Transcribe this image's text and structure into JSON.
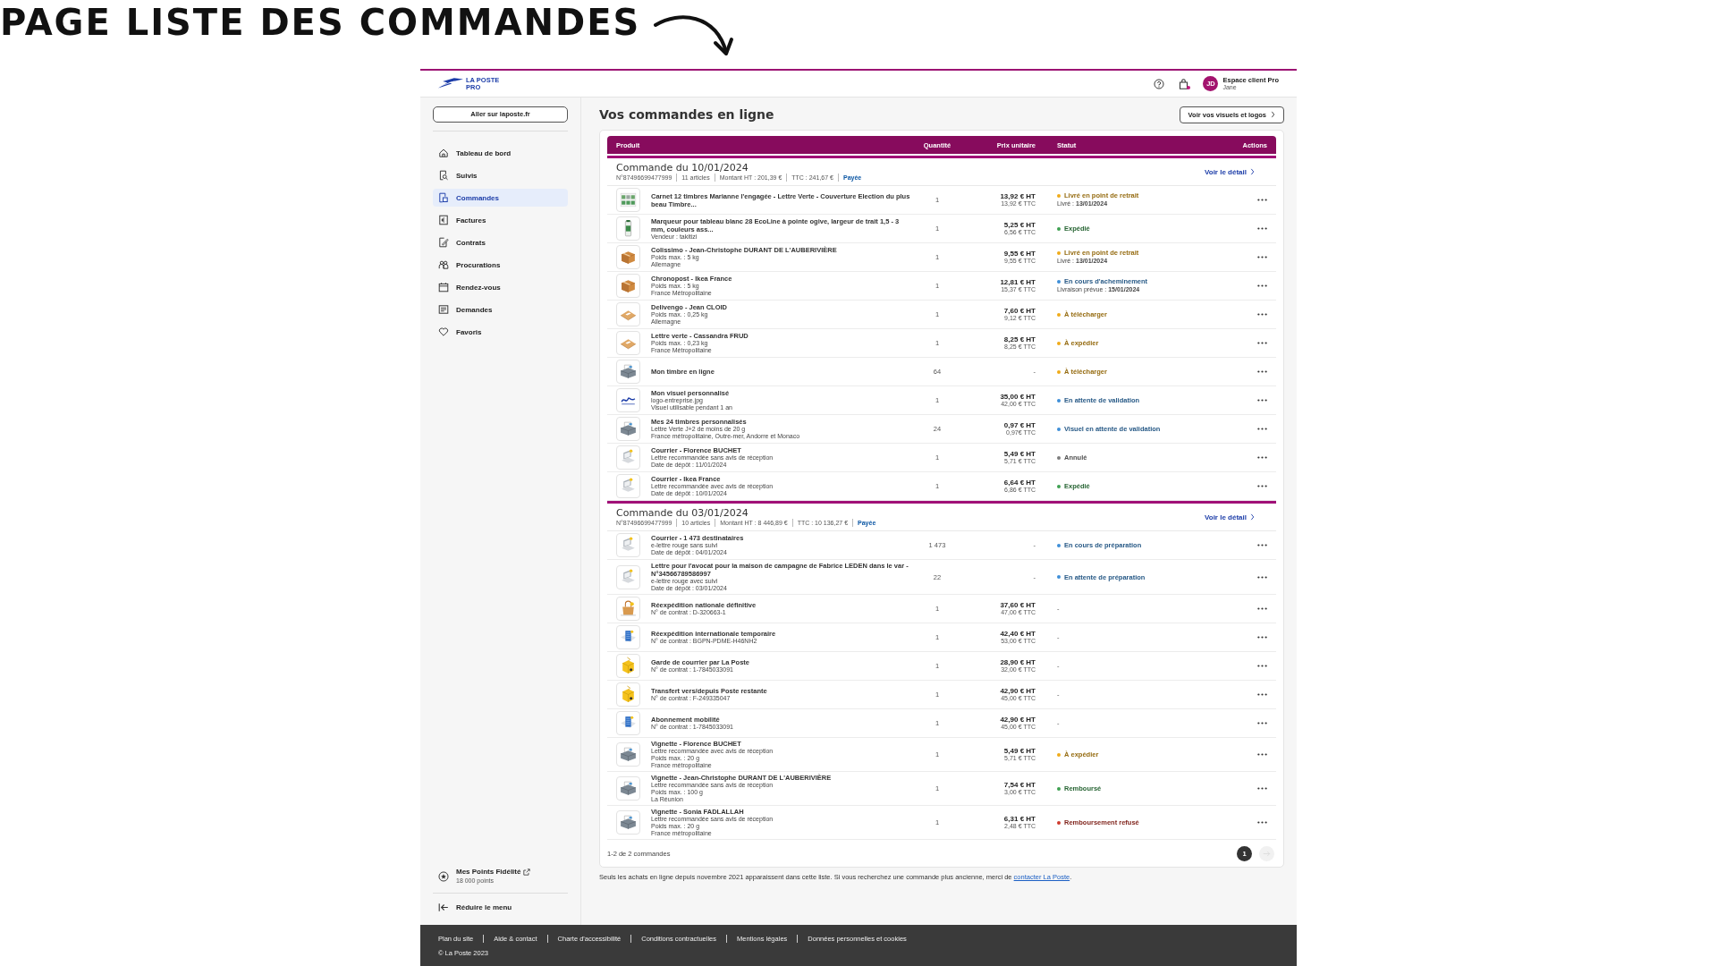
{
  "slide_title": "PAGE LISTE DES COMMANDES",
  "header": {
    "logo": [
      "LA POSTE",
      "PRO"
    ],
    "avatar": "JD",
    "account": "Espace client Pro",
    "user": "Jane",
    "cart_badge": true
  },
  "sidebar": {
    "top_button": "Aller sur laposte.fr",
    "items": [
      {
        "label": "Tableau de bord",
        "selected": false
      },
      {
        "label": "Suivis",
        "selected": false
      },
      {
        "label": "Commandes",
        "selected": true
      },
      {
        "label": "Factures",
        "selected": false
      },
      {
        "label": "Contrats",
        "selected": false
      },
      {
        "label": "Procurations",
        "selected": false
      },
      {
        "label": "Rendez-vous",
        "selected": false
      },
      {
        "label": "Demandes",
        "selected": false
      },
      {
        "label": "Favoris",
        "selected": false
      }
    ],
    "loyalty": {
      "title": "Mes Points Fidélité",
      "points": "18 000 points"
    },
    "collapse": "Réduire le menu"
  },
  "main": {
    "title": "Vos commandes en ligne",
    "visuals_button": "Voir vos visuels et logos",
    "columns": [
      "Produit",
      "Quantité",
      "Prix unitaire",
      "Statut",
      "Actions"
    ],
    "orders": [
      {
        "title": "Commande du 10/01/2024",
        "meta": [
          "N°87496699477999",
          "11 articles",
          "Montant HT : 201,39 €",
          "TTC : 241,67 €"
        ],
        "payment": "Payée",
        "detail_link": "Voir le détail",
        "items": [
          {
            "kind": "stamps",
            "name": "Carnet 12 timbres Marianne l'engagée - Lettre Verte - Couverture Election du plus beau Timbre...",
            "qty": "1",
            "price_ht": "13,92 € HT",
            "price_ttc": "13,92 € TTC",
            "status": {
              "label": "Livré en point de retrait",
              "color": "#f0ac1a",
              "detail": "Livré : **13/01/2024**"
            }
          },
          {
            "kind": "marker",
            "name": "Marqueur pour tableau blanc 28 EcoLine à pointe ogive, largeur de trait 1,5 - 3 mm, couleurs ass...",
            "lines": [
              "Vendeur : takitizi"
            ],
            "qty": "1",
            "price_ht": "5,25 € HT",
            "price_ttc": "6,56 € TTC",
            "status": {
              "label": "Expédié",
              "color": "#3fa152"
            }
          },
          {
            "kind": "parcel",
            "name": "Colissimo - Jean-Christophe DURANT DE L'AUBERIVIÈRE",
            "lines": [
              "Poids max. : 5 kg",
              "Allemagne"
            ],
            "qty": "1",
            "price_ht": "9,55 € HT",
            "price_ttc": "9,55 € TTC",
            "status": {
              "label": "Livré en point de retrait",
              "color": "#f0ac1a",
              "detail": "Livré : **13/01/2024**"
            }
          },
          {
            "kind": "parcel",
            "name": "Chronopost - Ikea France",
            "lines": [
              "Poids max. : 5 kg",
              "France Métropolitaine"
            ],
            "qty": "1",
            "price_ht": "12,81 € HT",
            "price_ttc": "15,37 € TTC",
            "status": {
              "label": "En cours d'acheminement",
              "color": "#3f8fd8",
              "detail": "Livraison prévue : **15/01/2024**"
            }
          },
          {
            "kind": "envelope",
            "name": "Delivengo - Jean CLOID",
            "lines": [
              "Poids max. : 0,25 kg",
              "Allemagne"
            ],
            "qty": "1",
            "price_ht": "7,60 € HT",
            "price_ttc": "9,12 € TTC",
            "status": {
              "label": "À télécharger",
              "color": "#f0ac1a"
            }
          },
          {
            "kind": "envelope",
            "name": "Lettre verte - Cassandra FRUD",
            "lines": [
              "Poids max. : 0,23 kg",
              "France Métropolitaine"
            ],
            "qty": "1",
            "price_ht": "8,25 € HT",
            "price_ttc": "8,25 € TTC",
            "status": {
              "label": "À expédier",
              "color": "#f0ac1a"
            }
          },
          {
            "kind": "printer",
            "name": "Mon timbre en ligne",
            "qty": "64",
            "price_ht": "-",
            "status": {
              "label": "À télécharger",
              "color": "#f0ac1a"
            }
          },
          {
            "kind": "logo",
            "name": "Mon visuel personnalisé",
            "lines": [
              "logo-entreprise.jpg",
              "Visuel utilisable pendant 1 an"
            ],
            "qty": "1",
            "price_ht": "35,00 € HT",
            "price_ttc": "42,00 € TTC",
            "status": {
              "label": "En attente de validation",
              "color": "#3f8fd8"
            }
          },
          {
            "kind": "printer",
            "name": "Mes 24 timbres personnalisés",
            "lines": [
              "Lettre Verte J+2 de moins de 20 g",
              "France métropolitaine, Outre-mer, Andorre et Monaco"
            ],
            "qty": "24",
            "price_ht": "0,97 € HT",
            "price_ttc": "0,97€ TTC",
            "status": {
              "label": "Visuel en attente de validation",
              "color": "#3f8fd8"
            }
          },
          {
            "kind": "laptop",
            "name": "Courrier - Florence BUCHET",
            "lines": [
              "Lettre recommandée sans avis de réception",
              "Date de dépôt : 11/01/2024"
            ],
            "qty": "1",
            "price_ht": "5,49 € HT",
            "price_ttc": "5,71 € TTC",
            "status": {
              "label": "Annulé",
              "color": "#7d7d7d"
            }
          },
          {
            "kind": "laptop",
            "name": "Courrier - Ikea France",
            "lines": [
              "Lettre recommandée avec avis de réception",
              "Date de dépôt : 10/01/2024"
            ],
            "qty": "1",
            "price_ht": "6,64 € HT",
            "price_ttc": "6,86 € TTC",
            "status": {
              "label": "Expédié",
              "color": "#3fa152"
            }
          }
        ]
      },
      {
        "title": "Commande du 03/01/2024",
        "meta": [
          "N°87496699477999",
          "10 articles",
          "Montant HT : 8 446,89 €",
          "TTC : 10 136,27 €"
        ],
        "payment": "Payée",
        "detail_link": "Voir le détail",
        "items": [
          {
            "kind": "laptop",
            "name": "Courrier - 1 473 destinataires",
            "lines": [
              "e-lettre rouge sans suivi",
              "Date de dépôt : 04/01/2024"
            ],
            "qty": "1 473",
            "price_ht": "-",
            "status": {
              "label": "En cours de préparation",
              "color": "#3f8fd8"
            }
          },
          {
            "kind": "laptop",
            "name": "Lettre pour l'avocat pour la maison de campagne de Fabrice LEDEN dans le var - N°34566789586997",
            "lines": [
              "e-lettre rouge avec suivi",
              "Date de dépôt : 03/01/2024"
            ],
            "qty": "22",
            "price_ht": "-",
            "status": {
              "label": "En attente de préparation",
              "color": "#3f8fd8"
            }
          },
          {
            "kind": "bag",
            "name": "Réexpédition nationale définitive",
            "lines": [
              "N° de contrat : D-320663-1"
            ],
            "qty": "1",
            "price_ht": "37,60 € HT",
            "price_ttc": "47,00 € TTC",
            "status": {
              "label": "-"
            }
          },
          {
            "kind": "building",
            "name": "Réexpédition internationale temporaire",
            "lines": [
              "N° de contrat : BGPN-PDME-H46NH2"
            ],
            "qty": "1",
            "price_ht": "42,40 € HT",
            "price_ttc": "53,00 € TTC",
            "status": {
              "label": "-"
            }
          },
          {
            "kind": "mailbox",
            "name": "Garde de courrier par La Poste",
            "lines": [
              "N° de contrat : 1-7845033091"
            ],
            "qty": "1",
            "price_ht": "28,90 € HT",
            "price_ttc": "32,00 € TTC",
            "status": {
              "label": "-"
            }
          },
          {
            "kind": "mailbox",
            "name": "Transfert vers/depuis Poste restante",
            "lines": [
              "N° de contrat : F-249335047"
            ],
            "qty": "1",
            "price_ht": "42,90 € HT",
            "price_ttc": "45,00 € TTC",
            "status": {
              "label": "-"
            }
          },
          {
            "kind": "building",
            "name": "Abonnement mobilité",
            "lines": [
              "N° de contrat : 1-7845033091"
            ],
            "qty": "1",
            "price_ht": "42,90 € HT",
            "price_ttc": "45,00 € TTC",
            "status": {
              "label": "-"
            }
          },
          {
            "kind": "printer",
            "name": "Vignette - Florence BUCHET",
            "lines": [
              "Lettre recommandée avec avis de réception",
              "Poids max. : 20 g",
              "France métropolitaine"
            ],
            "qty": "1",
            "price_ht": "5,49 € HT",
            "price_ttc": "5,71 € TTC",
            "status": {
              "label": "À expédier",
              "color": "#f0ac1a"
            }
          },
          {
            "kind": "printer",
            "name": "Vignette - Jean-Christophe DURANT DE L'AUBERIVIÈRE",
            "lines": [
              "Lettre recommandée sans avis de réception",
              "Poids max. : 100 g",
              "La Réunion"
            ],
            "qty": "1",
            "price_ht": "7,54 € HT",
            "price_ttc": "3,00 € TTC",
            "status": {
              "label": "Remboursé",
              "color": "#3fa152"
            }
          },
          {
            "kind": "printer",
            "name": "Vignette - Sonia FADLALLAH",
            "lines": [
              "Lettre recommandée sans avis de réception",
              "Poids max. : 20 g",
              "France métropolitaine"
            ],
            "qty": "1",
            "price_ht": "6,31 € HT",
            "price_ttc": "2,48 € TTC",
            "status": {
              "label": "Remboursement refusé",
              "color": "#cf3b2e"
            }
          }
        ]
      }
    ],
    "pagination": {
      "summary": "1-2 de 2 commandes",
      "pages": [
        {
          "label": "1",
          "selected": true
        }
      ],
      "next": {
        "disabled": true
      }
    },
    "notice": {
      "text": "Seuls les achats en ligne depuis novembre 2021 apparaissent dans cette liste. Si vous recherchez une commande plus ancienne, merci de ",
      "link": "contacter La Poste",
      "end": "."
    }
  },
  "footer": {
    "links": [
      "Plan du site",
      "Aide & contact",
      "Charte d'accessibilité",
      "Conditions contractuelles",
      "Mentions légales",
      "Données personnelles et cookies"
    ],
    "copyright": "© La Poste 2023"
  }
}
